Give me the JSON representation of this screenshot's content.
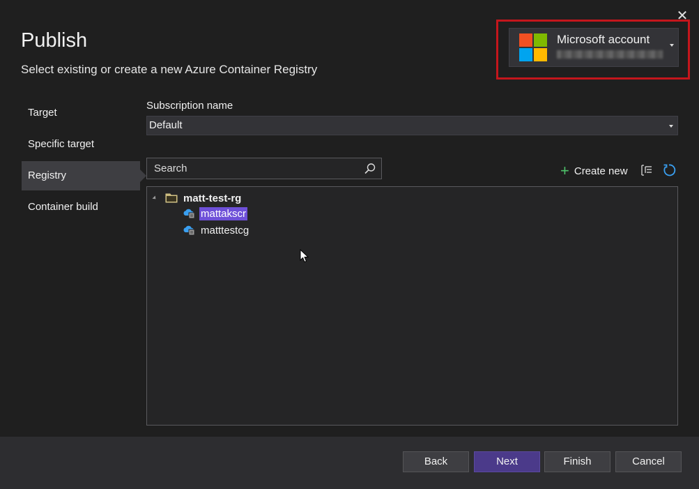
{
  "dialog": {
    "title": "Publish",
    "subtitle": "Select existing or create a new Azure Container Registry",
    "close_icon": "close-icon"
  },
  "account": {
    "name": "Microsoft account",
    "email": "",
    "logo_colors": [
      "#f25022",
      "#7fba00",
      "#00a4ef",
      "#ffb900"
    ],
    "highlight_color": "#c4161c"
  },
  "nav": {
    "items": [
      {
        "label": "Target"
      },
      {
        "label": "Specific target"
      },
      {
        "label": "Registry",
        "active": true
      },
      {
        "label": "Container build"
      }
    ]
  },
  "subscription": {
    "label": "Subscription name",
    "selected": "Default"
  },
  "search": {
    "placeholder": "Search",
    "value": ""
  },
  "toolbar": {
    "create_new_label": "Create new",
    "icons": [
      "plus-icon",
      "filter-icon",
      "refresh-icon"
    ]
  },
  "tree": {
    "group": {
      "label": "matt-test-rg",
      "icon": "folder-icon",
      "expanded": true,
      "children": [
        {
          "label": "mattakscr",
          "selected": true,
          "icon": "container-registry-icon"
        },
        {
          "label": "matttestcg",
          "selected": false,
          "icon": "container-registry-icon"
        }
      ]
    }
  },
  "footer": {
    "back_label": "Back",
    "next_label": "Next",
    "finish_label": "Finish",
    "cancel_label": "Cancel"
  },
  "colors": {
    "background": "#1f1f1f",
    "panel": "#252526",
    "accent": "#6e50d8",
    "primary_button": "#4b3a8a"
  }
}
